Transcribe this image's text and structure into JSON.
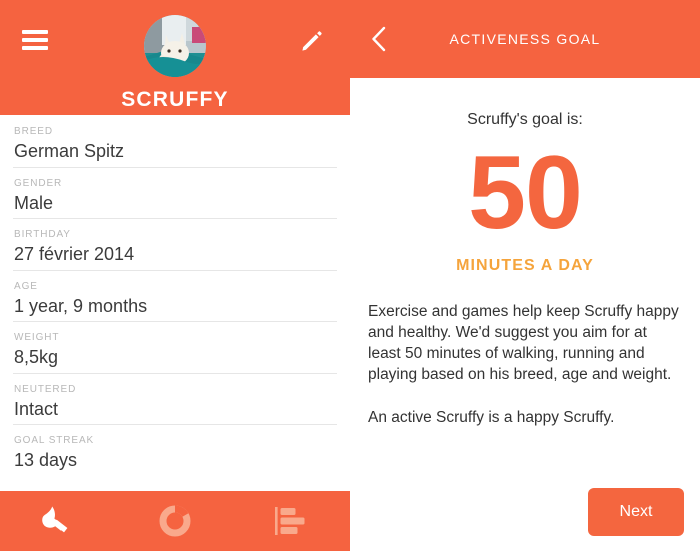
{
  "brand": {
    "orange": "#F56340",
    "orange_accent": "#F4663F",
    "amber": "#F5A43C",
    "tab_inactive": "#F9A98C",
    "white": "#FFFFFF"
  },
  "left_panel": {
    "menu_icon": "hamburger-menu-icon",
    "edit_icon": "pencil-edit-icon",
    "avatar_icon": "pet-avatar-photo",
    "pet_name": "SCRUFFY",
    "fields": [
      {
        "label": "BREED",
        "value": "German Spitz"
      },
      {
        "label": "GENDER",
        "value": "Male"
      },
      {
        "label": "BIRTHDAY",
        "value": "27 février 2014"
      },
      {
        "label": "AGE",
        "value": "1 year, 9 months"
      },
      {
        "label": "WEIGHT",
        "value": "8,5kg"
      },
      {
        "label": "NEUTERED",
        "value": "Intact"
      },
      {
        "label": "GOAL STREAK",
        "value": "13 days"
      }
    ],
    "tabs": [
      {
        "name": "profile",
        "icon": "dog-head-icon",
        "active": true
      },
      {
        "name": "activity",
        "icon": "donut-chart-icon",
        "active": false
      },
      {
        "name": "stats",
        "icon": "bar-chart-icon",
        "active": false
      }
    ]
  },
  "right_panel": {
    "back_icon": "chevron-left-icon",
    "title": "ACTIVENESS GOAL",
    "intro": "Scruffy's goal is:",
    "number": "50",
    "unit": "MINUTES A DAY",
    "paragraph_1": "Exercise and games help keep Scruffy happy and healthy. We'd suggest you aim for at least 50 minutes of walking, running and playing based on his breed, age and weight.",
    "paragraph_2": "An active Scruffy is a happy Scruffy.",
    "next_label": "Next"
  }
}
